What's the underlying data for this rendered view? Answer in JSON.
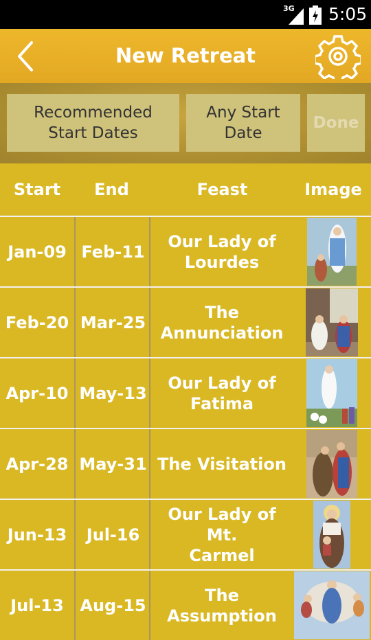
{
  "status_bar": {
    "network": "3G",
    "time": "5:05"
  },
  "action_bar": {
    "title": "New Retreat"
  },
  "buttons": {
    "recommended_line1": "Recommended",
    "recommended_line2": "Start Dates",
    "any_line1": "Any Start",
    "any_line2": "Date",
    "done": "Done"
  },
  "table": {
    "headers": [
      "Start",
      "End",
      "Feast",
      "Image"
    ],
    "rows": [
      {
        "start": "Jan-09",
        "end": "Feb-11",
        "feast_line1": "Our Lady of",
        "feast_line2": "Lourdes"
      },
      {
        "start": "Feb-20",
        "end": "Mar-25",
        "feast_line1": "The",
        "feast_line2": "Annunciation"
      },
      {
        "start": "Apr-10",
        "end": "May-13",
        "feast_line1": "Our Lady of",
        "feast_line2": "Fatima"
      },
      {
        "start": "Apr-28",
        "end": "May-31",
        "feast_line1": "The Visitation",
        "feast_line2": ""
      },
      {
        "start": "Jun-13",
        "end": "Jul-16",
        "feast_line1": "Our Lady of Mt.",
        "feast_line2": "Carmel"
      },
      {
        "start": "Jul-13",
        "end": "Aug-15",
        "feast_line1": "The Assumption",
        "feast_line2": ""
      }
    ]
  },
  "colors": {
    "background": "#d9b823",
    "action_bar": "#e6ad25",
    "button_bg": "#cfc27b"
  }
}
